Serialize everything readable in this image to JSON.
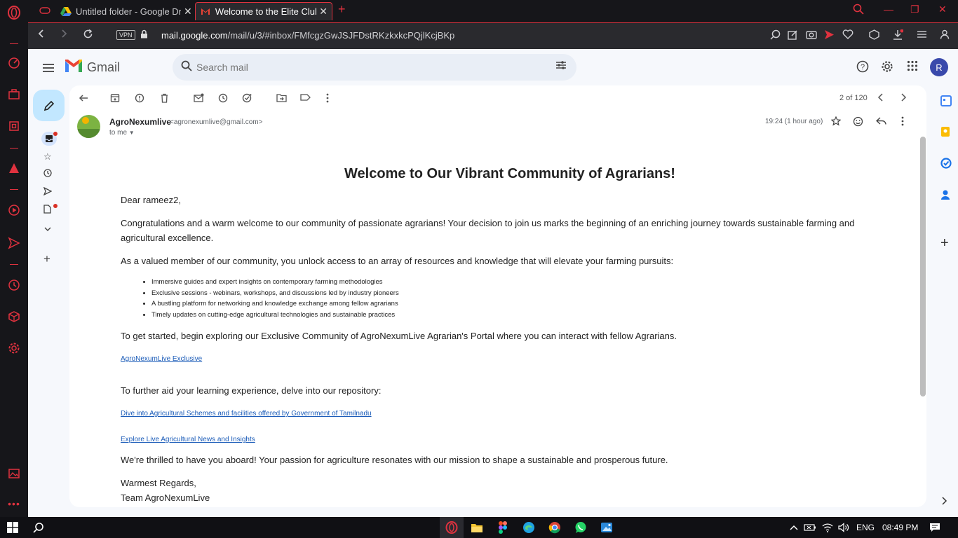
{
  "tabs": [
    {
      "title": "Untitled folder - Google Drive",
      "active": false
    },
    {
      "title": "Welcome to the Elite Club of AgroNexumLive",
      "active": true
    }
  ],
  "address": {
    "vpn": "VPN",
    "url_host": "mail.google.com",
    "url_path": "/mail/u/3/#inbox/FMfcgzGwJSJFDstRKzkxkcPQjlKcjBKp"
  },
  "gmail": {
    "logo_text": "Gmail",
    "search_placeholder": "Search mail",
    "avatar_letter": "R",
    "counter": "2 of 120"
  },
  "email": {
    "sender_name": "AgroNexumlive",
    "sender_email": "<agronexumlive@gmail.com>",
    "to": "to me",
    "time": "19:24 (1 hour ago)",
    "heading": "Welcome to Our Vibrant Community of Agrarians!",
    "greeting": "Dear rameez2,",
    "para1": "Congratulations and a warm welcome to our community of passionate agrarians! Your decision to join us marks the beginning of an enriching journey towards sustainable farming and agricultural excellence.",
    "para2": "As a valued member of our community, you unlock access to an array of resources and knowledge that will elevate your farming pursuits:",
    "bullets": [
      "Immersive guides and expert insights on contemporary farming methodologies",
      "Exclusive sessions - webinars, workshops, and discussions led by industry pioneers",
      "A bustling platform for networking and knowledge exchange among fellow agrarians",
      "Timely updates on cutting-edge agricultural technologies and sustainable practices"
    ],
    "para3": "To get started, begin exploring our Exclusive Community of AgroNexumLive Agrarian's Portal where you can interact with fellow Agrarians.",
    "link1": "AgroNexumLive Exclusive",
    "para4": "To further aid your learning experience, delve into our repository:",
    "link2": "Dive into Agricultural Schemes and facilities offered by Government of Tamilnadu",
    "link3": "Explore Live Agricultural News and Insights",
    "para5": "We're thrilled to have you aboard! Your passion for agriculture resonates with our mission to shape a sustainable and prosperous future.",
    "signoff1": "Warmest Regards,",
    "signoff2": "Team AgroNexumLive"
  },
  "taskbar": {
    "language": "ENG",
    "clock": "08:49 PM"
  },
  "colors": {
    "opera_accent": "#e0323f",
    "gmail_bg": "#f6f8fc",
    "compose_bg": "#c2e7ff",
    "link": "#1a5bb8"
  }
}
